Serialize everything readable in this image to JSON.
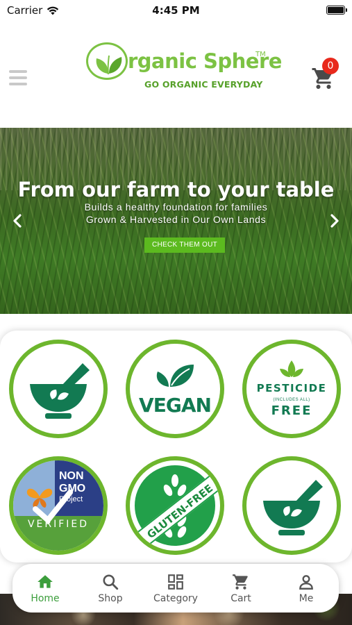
{
  "status_bar": {
    "carrier": "Carrier",
    "time": "4:45 PM"
  },
  "header": {
    "logo_name": "rganic Sphere",
    "logo_tm": "TM",
    "logo_tagline": "GO ORGANIC EVERYDAY",
    "cart_count": "0"
  },
  "banner": {
    "title": "From our farm to your table",
    "subtitle_line1": "Builds a healthy foundation for families",
    "subtitle_line2": "Grown & Harvested in Our Own Lands",
    "cta_label": "CHECK THEM OUT"
  },
  "badges": {
    "vegan": "VEGAN",
    "pesticide_top": "PESTICIDE",
    "pesticide_small": "(INCLUDES ALL)",
    "pesticide_bottom": "FREE",
    "gmo_line1": "NON",
    "gmo_line2": "GMO",
    "gmo_line3": "Project",
    "gmo_verified": "VERIFIED",
    "gluten_free": "GLUTEN-FREE"
  },
  "tabbar": {
    "items": [
      {
        "label": "Home",
        "icon": "home-icon",
        "active": true
      },
      {
        "label": "Shop",
        "icon": "search-icon"
      },
      {
        "label": "Category",
        "icon": "grid-icon"
      },
      {
        "label": "Cart",
        "icon": "cart-icon"
      },
      {
        "label": "Me",
        "icon": "person-icon"
      }
    ]
  },
  "colors": {
    "brand_green": "#7cc243",
    "badge_green": "#127a52",
    "active_tab": "#3c9e3c",
    "cart_badge": "#e8291c"
  }
}
